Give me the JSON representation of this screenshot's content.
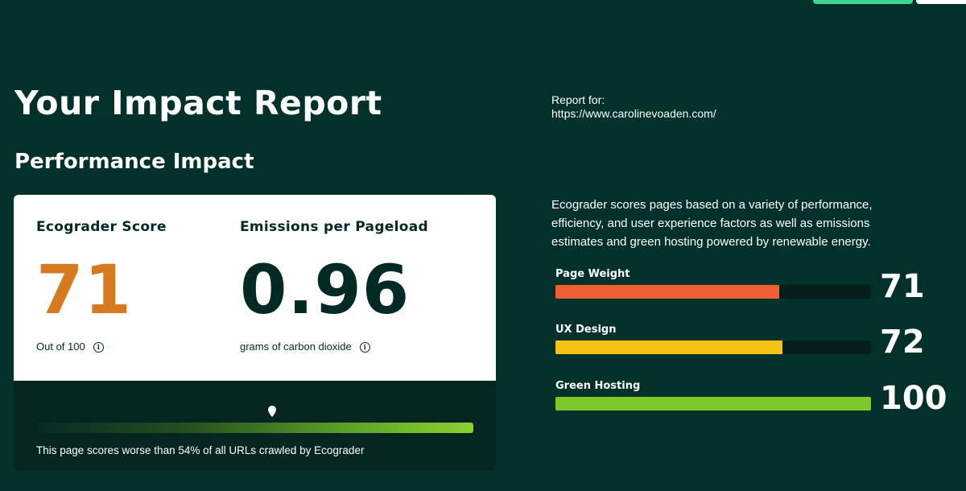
{
  "page": {
    "title": "Your Impact Report",
    "section_title": "Performance Impact"
  },
  "report": {
    "label": "Report for:",
    "url": "https://www.carolinevoaden.com/"
  },
  "description": "Ecograder scores pages based on a variety of performance, efficiency, and user experience factors as well as emissions estimates and green hosting powered by renewable energy.",
  "score_card": {
    "score_label": "Ecograder Score",
    "score_value": "71",
    "score_sub": "Out of 100",
    "emissions_label": "Emissions per Pageload",
    "emissions_value": "0.96",
    "emissions_sub": "grams of carbon dioxide",
    "percentile_text": "This page scores worse than 54% of all URLs crawled by Ecograder",
    "percentile": 54,
    "info_icon": "info-icon",
    "marker_icon": "location-pin-icon"
  },
  "factors": [
    {
      "label": "Page Weight",
      "score": "71",
      "fill": 0.71,
      "color": "#ee5f34"
    },
    {
      "label": "UX Design",
      "score": "72",
      "fill": 0.72,
      "color": "#f5c412"
    },
    {
      "label": "Green Hosting",
      "score": "100",
      "fill": 1.0,
      "color": "#7ec72b"
    }
  ],
  "colors": {
    "background": "#02312b",
    "score_accent": "#d77a1f",
    "top_button": "#3fd68f"
  }
}
